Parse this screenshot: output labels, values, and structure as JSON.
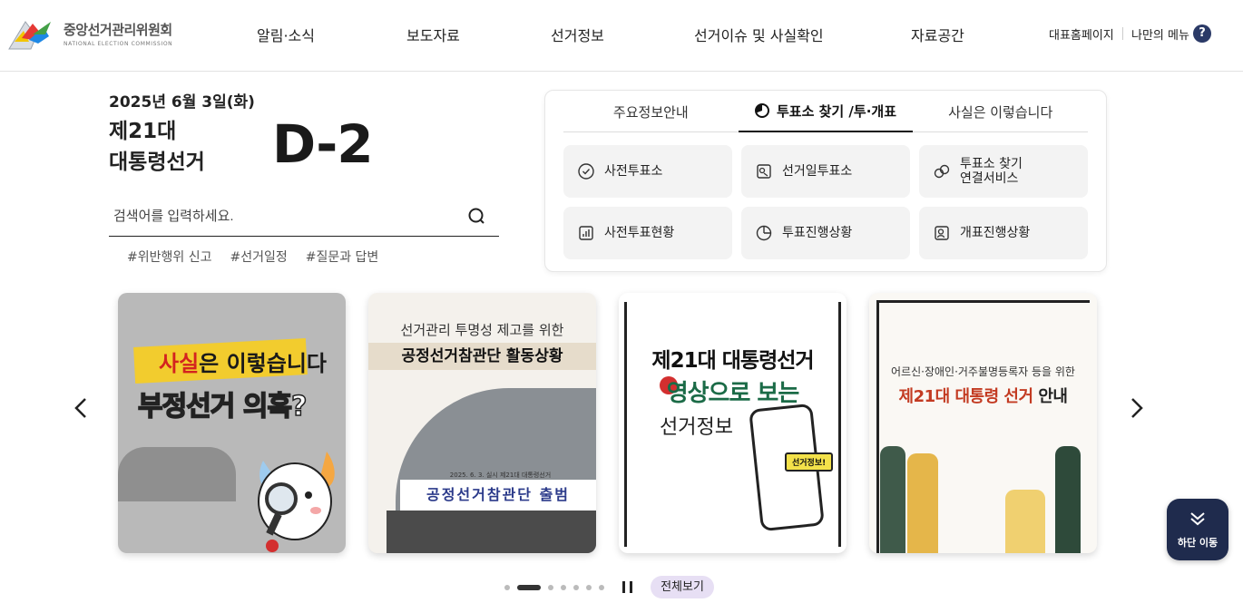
{
  "header": {
    "logo_ko": "중앙선거관리위원회",
    "logo_en": "NATIONAL ELECTION COMMISSION",
    "nav": [
      "알림·소식",
      "보도자료",
      "선거정보",
      "선거이슈 및 사실확인",
      "자료공간"
    ],
    "util": [
      "대표홈페이지",
      "나만의 메뉴"
    ],
    "help": "?"
  },
  "election": {
    "date": "2025년 6월 3일(화)",
    "title_line1": "제21대",
    "title_line2": "대통령선거",
    "dday": "D-2"
  },
  "search": {
    "placeholder": "검색어를 입력하세요.",
    "tags": [
      "#위반행위 신고",
      "#선거일정",
      "#질문과 답변"
    ]
  },
  "panel": {
    "tabs": [
      "주요정보안내",
      "투표소 찾기 /투·개표",
      "사실은 이렇습니다"
    ],
    "active_tab": 1,
    "services": [
      {
        "label": "사전투표소",
        "icon": "check-circle-icon"
      },
      {
        "label": "선거일투표소",
        "icon": "ballot-icon"
      },
      {
        "label": "투표소 찾기\n연결서비스",
        "icon": "link-icon"
      },
      {
        "label": "사전투표현황",
        "icon": "bar-chart-icon"
      },
      {
        "label": "투표진행상황",
        "icon": "pie-chart-icon"
      },
      {
        "label": "개표진행상황",
        "icon": "person-check-icon"
      }
    ]
  },
  "carousel": {
    "cards": [
      {
        "line1_accent": "사실",
        "line1_rest": "은 이렇습니다",
        "line2": "부정선거 의혹?"
      },
      {
        "line1": "선거관리 투명성 제고를 위한",
        "line2": "공정선거참관단 활동상황",
        "photo_sub": "2025. 6. 3. 실시 제21대 대통령선거",
        "banner": "공정선거참관단 출범"
      },
      {
        "line1": "제21대 대통령선거",
        "line2": "영상으로 보는",
        "line3": "선거정보",
        "sticker": "선거정보!"
      },
      {
        "line1": "어르신·장애인·거주불명등록자 등을 위한",
        "line2_accent": "제21대 대통령 선거",
        "line2_rest": " 안내"
      }
    ],
    "dots": 7,
    "active_dot": 1,
    "view_all": "전체보기"
  },
  "float_button": {
    "label": "하단 이동"
  },
  "colors": {
    "navy": "#1f2b4d",
    "accent_purple": "#e7dff4"
  }
}
